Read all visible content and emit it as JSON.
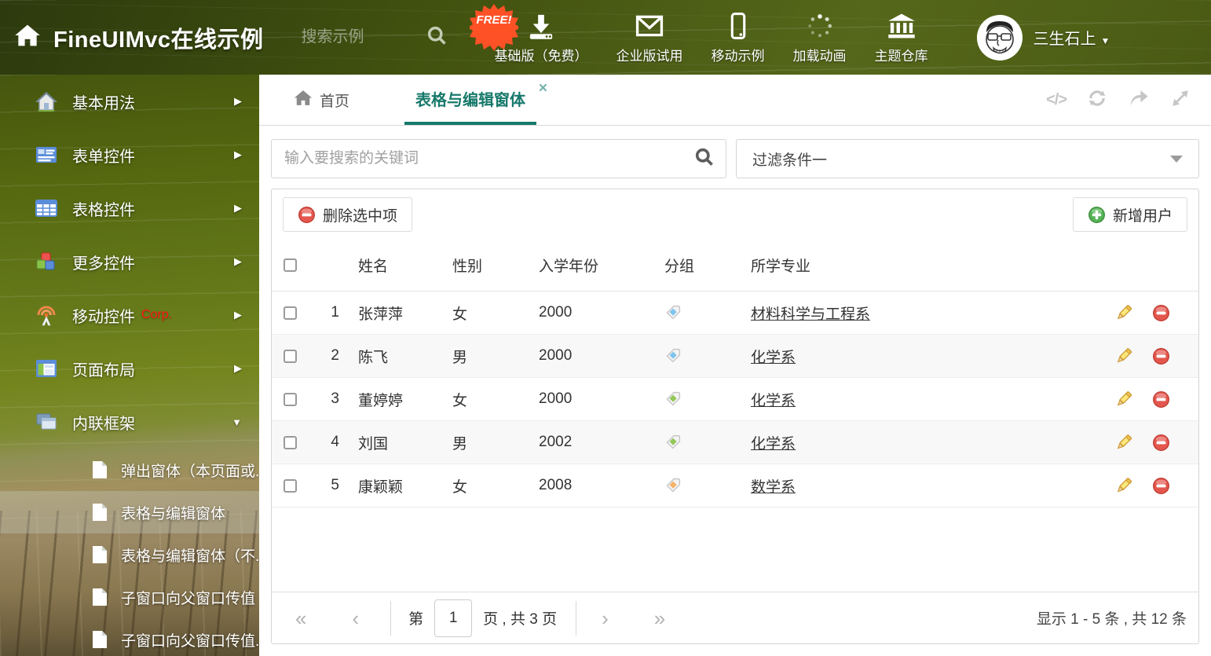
{
  "header": {
    "title": "FineUIMvc在线示例",
    "search_placeholder": "搜索示例",
    "free_badge": "FREE!",
    "nav_items": [
      {
        "label": "基础版（免费）",
        "icon": "download-icon"
      },
      {
        "label": "企业版试用",
        "icon": "envelope-icon"
      },
      {
        "label": "移动示例",
        "icon": "mobile-icon"
      },
      {
        "label": "加载动画",
        "icon": "spinner-icon"
      },
      {
        "label": "主题仓库",
        "icon": "bank-icon"
      }
    ],
    "username": "三生石上"
  },
  "sidebar": {
    "items": [
      {
        "label": "基本用法",
        "icon": "home-icon"
      },
      {
        "label": "表单控件",
        "icon": "form-icon"
      },
      {
        "label": "表格控件",
        "icon": "grid-icon"
      },
      {
        "label": "更多控件",
        "icon": "cubes-icon"
      },
      {
        "label": "移动控件",
        "badge": "Corp.",
        "icon": "antenna-icon"
      },
      {
        "label": "页面布局",
        "icon": "layout-icon"
      },
      {
        "label": "内联框架",
        "icon": "frames-icon"
      }
    ],
    "subitems": [
      {
        "label": "弹出窗体（本页面或..."
      },
      {
        "label": "表格与编辑窗体"
      },
      {
        "label": "表格与编辑窗体（不..."
      },
      {
        "label": "子窗口向父窗口传值"
      },
      {
        "label": "子窗口向父窗口传值..."
      }
    ]
  },
  "tabs": {
    "home": "首页",
    "active": "表格与编辑窗体",
    "close": "×"
  },
  "filters": {
    "search_placeholder": "输入要搜索的关键词",
    "filter_value": "过滤条件一"
  },
  "toolbar": {
    "delete_label": "删除选中项",
    "add_label": "新增用户"
  },
  "table": {
    "columns": [
      "姓名",
      "性别",
      "入学年份",
      "分组",
      "所学专业"
    ],
    "rows": [
      {
        "index": "1",
        "name": "张萍萍",
        "gender": "女",
        "year": "2000",
        "tag_color": "#7fc3ee",
        "major": "材料科学与工程系"
      },
      {
        "index": "2",
        "name": "陈飞",
        "gender": "男",
        "year": "2000",
        "tag_color": "#7fc3ee",
        "major": "化学系"
      },
      {
        "index": "3",
        "name": "董婷婷",
        "gender": "女",
        "year": "2000",
        "tag_color": "#93c85a",
        "major": "化学系"
      },
      {
        "index": "4",
        "name": "刘国",
        "gender": "男",
        "year": "2002",
        "tag_color": "#93c85a",
        "major": "化学系"
      },
      {
        "index": "5",
        "name": "康颖颖",
        "gender": "女",
        "year": "2008",
        "tag_color": "#f6b266",
        "major": "数学系"
      }
    ]
  },
  "pagination": {
    "first": "«",
    "prev": "‹",
    "next": "›",
    "last": "»",
    "page_prefix": "第",
    "current_page": "1",
    "page_suffix": "页 , 共 3 页",
    "summary": "显示 1 - 5 条 , 共 12 条"
  },
  "colors": {
    "accent_teal": "#17796b",
    "delete_red": "#e2574c",
    "add_green": "#55b355",
    "free_orange": "#ff5126"
  }
}
